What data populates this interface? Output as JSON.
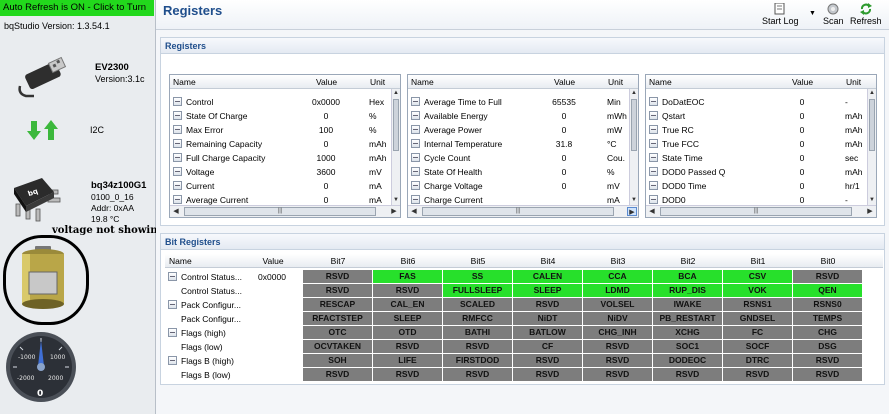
{
  "left": {
    "auto_refresh": "Auto Refresh is ON - Click to Turn",
    "version": "bqStudio Version:  1.3.54.1",
    "adapter": {
      "name": "EV2300",
      "version": "Version:3.1c"
    },
    "bus": "I2C",
    "device": {
      "name": "bq34z100G1",
      "id": "0100_0_16",
      "addr": "Addr: 0xAA",
      "temp": "19.8 °C"
    },
    "annotation": "voltage not showing",
    "gauge": {
      "labels": [
        "-1000",
        "1000",
        "-2000",
        "2000"
      ],
      "value": "0"
    }
  },
  "toolbar": {
    "title": "Registers",
    "start_log": "Start Log",
    "scan": "Scan",
    "refresh": "Refresh"
  },
  "registers": {
    "section_title": "Registers",
    "columns": {
      "name": "Name",
      "value": "Value",
      "unit": "Unit"
    },
    "tables": [
      {
        "rows": [
          {
            "name": "Control",
            "value": "0x0000",
            "unit": "Hex"
          },
          {
            "name": "State Of Charge",
            "value": "0",
            "unit": "%"
          },
          {
            "name": "Max Error",
            "value": "100",
            "unit": "%"
          },
          {
            "name": "Remaining Capacity",
            "value": "0",
            "unit": "mAh"
          },
          {
            "name": "Full Charge Capacity",
            "value": "1000",
            "unit": "mAh"
          },
          {
            "name": "Voltage",
            "value": "3600",
            "unit": "mV"
          },
          {
            "name": "Current",
            "value": "0",
            "unit": "mA"
          },
          {
            "name": "Average Current",
            "value": "0",
            "unit": "mA"
          }
        ]
      },
      {
        "rows": [
          {
            "name": "Average Time to Full",
            "value": "65535",
            "unit": "Min"
          },
          {
            "name": "Available Energy",
            "value": "0",
            "unit": "mWh"
          },
          {
            "name": "Average Power",
            "value": "0",
            "unit": "mW"
          },
          {
            "name": "Internal Temperature",
            "value": "31.8",
            "unit": "°C"
          },
          {
            "name": "Cycle Count",
            "value": "0",
            "unit": "Cou."
          },
          {
            "name": "State Of Health",
            "value": "0",
            "unit": "%"
          },
          {
            "name": "Charge Voltage",
            "value": "0",
            "unit": "mV"
          },
          {
            "name": "Charge Current",
            "value": "",
            "unit": "mA"
          }
        ]
      },
      {
        "rows": [
          {
            "name": "DoDatEOC",
            "value": "0",
            "unit": "-"
          },
          {
            "name": "Qstart",
            "value": "0",
            "unit": "mAh"
          },
          {
            "name": "True RC",
            "value": "0",
            "unit": "mAh"
          },
          {
            "name": "True FCC",
            "value": "0",
            "unit": "mAh"
          },
          {
            "name": "State Time",
            "value": "0",
            "unit": "sec"
          },
          {
            "name": "DOD0 Passed Q",
            "value": "0",
            "unit": "mAh"
          },
          {
            "name": "DOD0 Time",
            "value": "0",
            "unit": "hr/1"
          },
          {
            "name": "DOD0",
            "value": "0",
            "unit": "-"
          }
        ]
      }
    ]
  },
  "bit_registers": {
    "section_title": "Bit Registers",
    "columns": [
      "Name",
      "Value",
      "Bit7",
      "Bit6",
      "Bit5",
      "Bit4",
      "Bit3",
      "Bit2",
      "Bit1",
      "Bit0"
    ],
    "rows": [
      {
        "name": "Control Status...",
        "value": "0x0000",
        "checkbox": true,
        "bits": [
          [
            "RSVD",
            0
          ],
          [
            "FAS",
            1
          ],
          [
            "SS",
            1
          ],
          [
            "CALEN",
            1
          ],
          [
            "CCA",
            1
          ],
          [
            "BCA",
            1
          ],
          [
            "CSV",
            1
          ],
          [
            "RSVD",
            0
          ]
        ]
      },
      {
        "name": "Control Status...",
        "value": "",
        "checkbox": false,
        "bits": [
          [
            "RSVD",
            0
          ],
          [
            "RSVD",
            0
          ],
          [
            "FULLSLEEP",
            1
          ],
          [
            "SLEEP",
            1
          ],
          [
            "LDMD",
            1
          ],
          [
            "RUP_DIS",
            1
          ],
          [
            "VOK",
            1
          ],
          [
            "QEN",
            1
          ]
        ]
      },
      {
        "name": "Pack Configur...",
        "value": "",
        "checkbox": true,
        "bits": [
          [
            "RESCAP",
            0
          ],
          [
            "CAL_EN",
            0
          ],
          [
            "SCALED",
            0
          ],
          [
            "RSVD",
            0
          ],
          [
            "VOLSEL",
            0
          ],
          [
            "IWAKE",
            0
          ],
          [
            "RSNS1",
            0
          ],
          [
            "RSNS0",
            0
          ]
        ]
      },
      {
        "name": "Pack Configur...",
        "value": "",
        "checkbox": false,
        "bits": [
          [
            "RFACTSTEP",
            0
          ],
          [
            "SLEEP",
            0
          ],
          [
            "RMFCC",
            0
          ],
          [
            "NiDT",
            0
          ],
          [
            "NiDV",
            0
          ],
          [
            "PB_RESTART",
            0
          ],
          [
            "GNDSEL",
            0
          ],
          [
            "TEMPS",
            0
          ]
        ]
      },
      {
        "name": "Flags (high)",
        "value": "",
        "checkbox": true,
        "bits": [
          [
            "OTC",
            0
          ],
          [
            "OTD",
            0
          ],
          [
            "BATHI",
            0
          ],
          [
            "BATLOW",
            0
          ],
          [
            "CHG_INH",
            0
          ],
          [
            "XCHG",
            0
          ],
          [
            "FC",
            0
          ],
          [
            "CHG",
            0
          ]
        ]
      },
      {
        "name": "Flags (low)",
        "value": "",
        "checkbox": false,
        "bits": [
          [
            "OCVTAKEN",
            0
          ],
          [
            "RSVD",
            0
          ],
          [
            "RSVD",
            0
          ],
          [
            "CF",
            0
          ],
          [
            "RSVD",
            0
          ],
          [
            "SOC1",
            0
          ],
          [
            "SOCF",
            0
          ],
          [
            "DSG",
            0
          ]
        ]
      },
      {
        "name": "Flags B (high)",
        "value": "",
        "checkbox": true,
        "bits": [
          [
            "SOH",
            0
          ],
          [
            "LIFE",
            0
          ],
          [
            "FIRSTDOD",
            0
          ],
          [
            "RSVD",
            0
          ],
          [
            "RSVD",
            0
          ],
          [
            "DODEOC",
            0
          ],
          [
            "DTRC",
            0
          ],
          [
            "RSVD",
            0
          ]
        ]
      },
      {
        "name": "Flags B (low)",
        "value": "",
        "checkbox": false,
        "bits": [
          [
            "RSVD",
            0
          ],
          [
            "RSVD",
            0
          ],
          [
            "RSVD",
            0
          ],
          [
            "RSVD",
            0
          ],
          [
            "RSVD",
            0
          ],
          [
            "RSVD",
            0
          ],
          [
            "RSVD",
            0
          ],
          [
            "RSVD",
            0
          ]
        ]
      }
    ]
  },
  "colors": {
    "on": "#27e02b",
    "off": "#7d7d7d",
    "accent": "#1f4e8c"
  }
}
